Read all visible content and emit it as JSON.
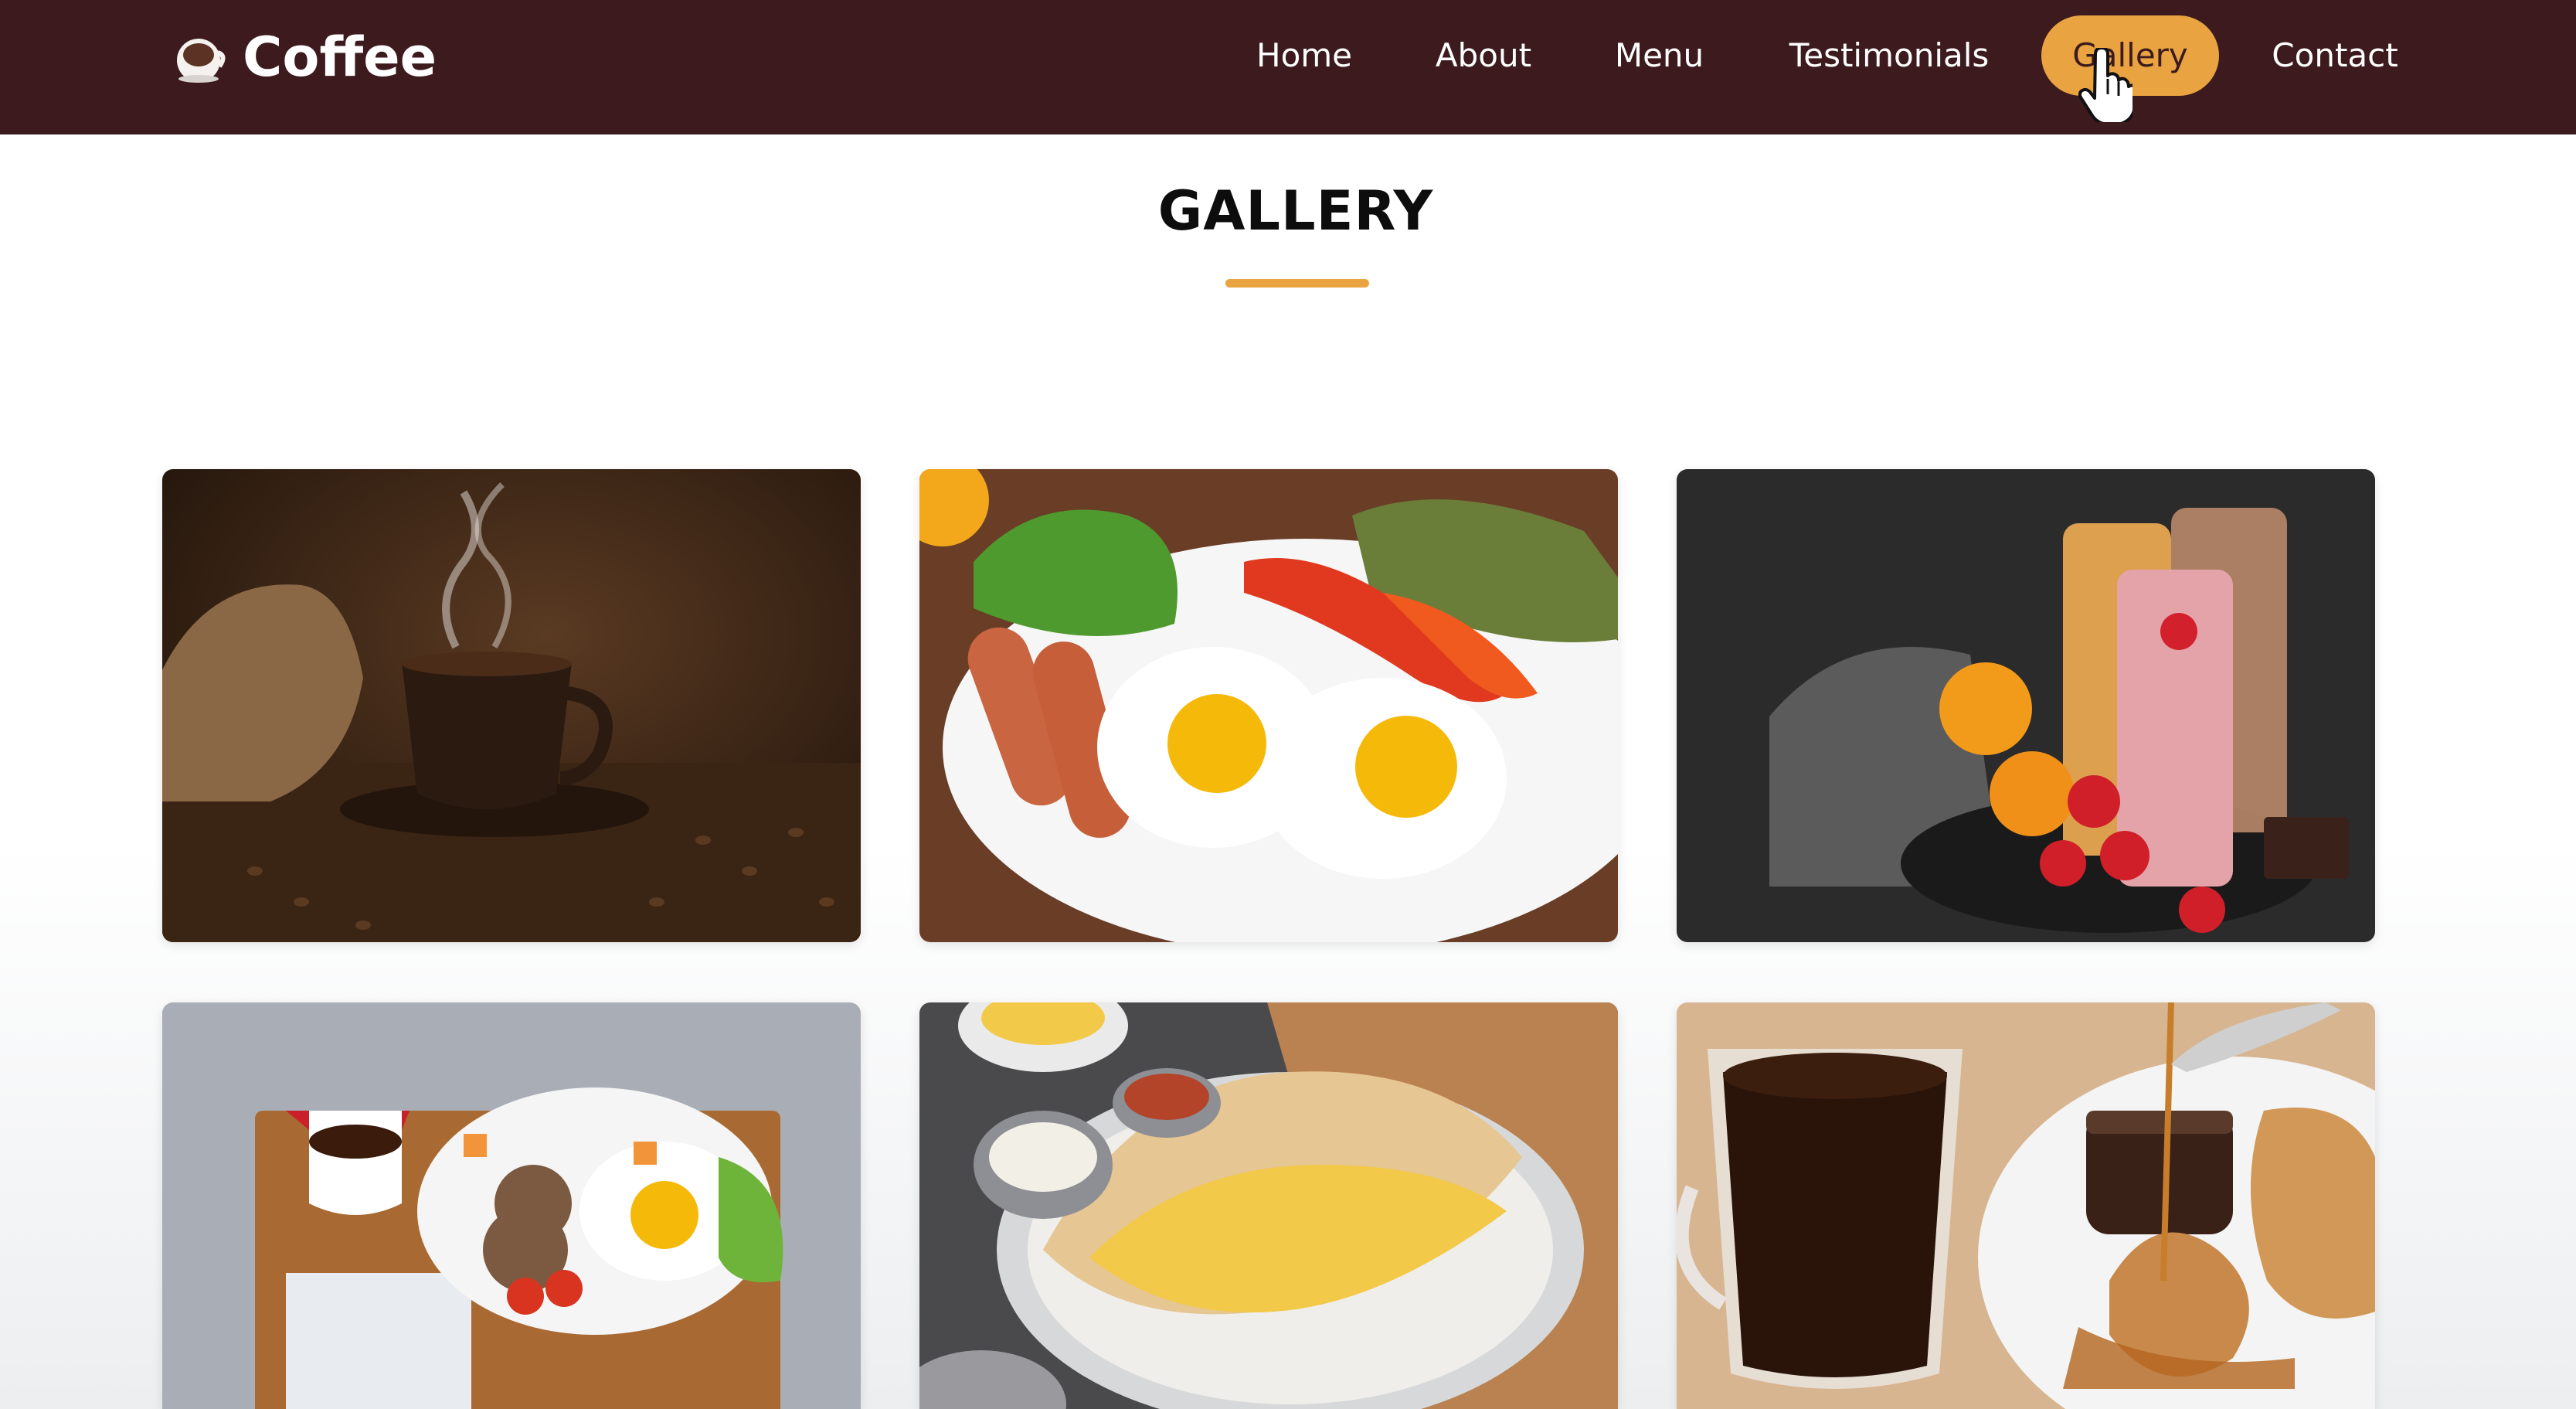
{
  "brand": {
    "name": "Coffee",
    "icon": "coffee-cup-icon"
  },
  "nav": {
    "items": [
      {
        "label": "Home",
        "active": false
      },
      {
        "label": "About",
        "active": false
      },
      {
        "label": "Menu",
        "active": false
      },
      {
        "label": "Testimonials",
        "active": false
      },
      {
        "label": "Gallery",
        "active": true
      },
      {
        "label": "Contact",
        "active": false
      }
    ]
  },
  "gallery": {
    "title": "GALLERY",
    "photos": [
      {
        "subject": "steaming coffee cup on saucer with coffee beans"
      },
      {
        "subject": "fried eggs with sausages, peppers and greens"
      },
      {
        "subject": "fruit smoothies with strawberries and peaches"
      },
      {
        "subject": "breakfast tray with coffee, toast and fried egg"
      },
      {
        "subject": "potato filled dosa with chutneys"
      },
      {
        "subject": "black coffee with croissant and honey"
      }
    ]
  },
  "colors": {
    "navbar_bg": "#3d1a1e",
    "accent": "#e9a441",
    "nav_text": "#ffffff",
    "title_text": "#0d0d0d"
  }
}
